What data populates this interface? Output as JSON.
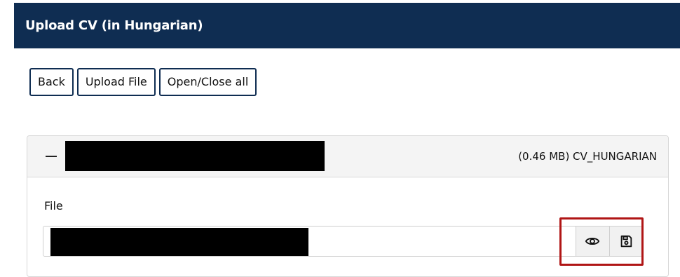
{
  "header": {
    "title": "Upload CV (in Hungarian)"
  },
  "toolbar": {
    "back_label": "Back",
    "upload_label": "Upload File",
    "toggle_all_label": "Open/Close all"
  },
  "file_panel": {
    "meta": "(0.46 MB) CV_HUNGARIAN",
    "field_label": "File",
    "collapse_icon": "minus-icon",
    "view_icon": "eye-icon",
    "save_icon": "floppy-disk-icon"
  },
  "colors": {
    "header_bg": "#0f2d52",
    "button_border": "#0f2d52",
    "highlight": "#b01515"
  }
}
